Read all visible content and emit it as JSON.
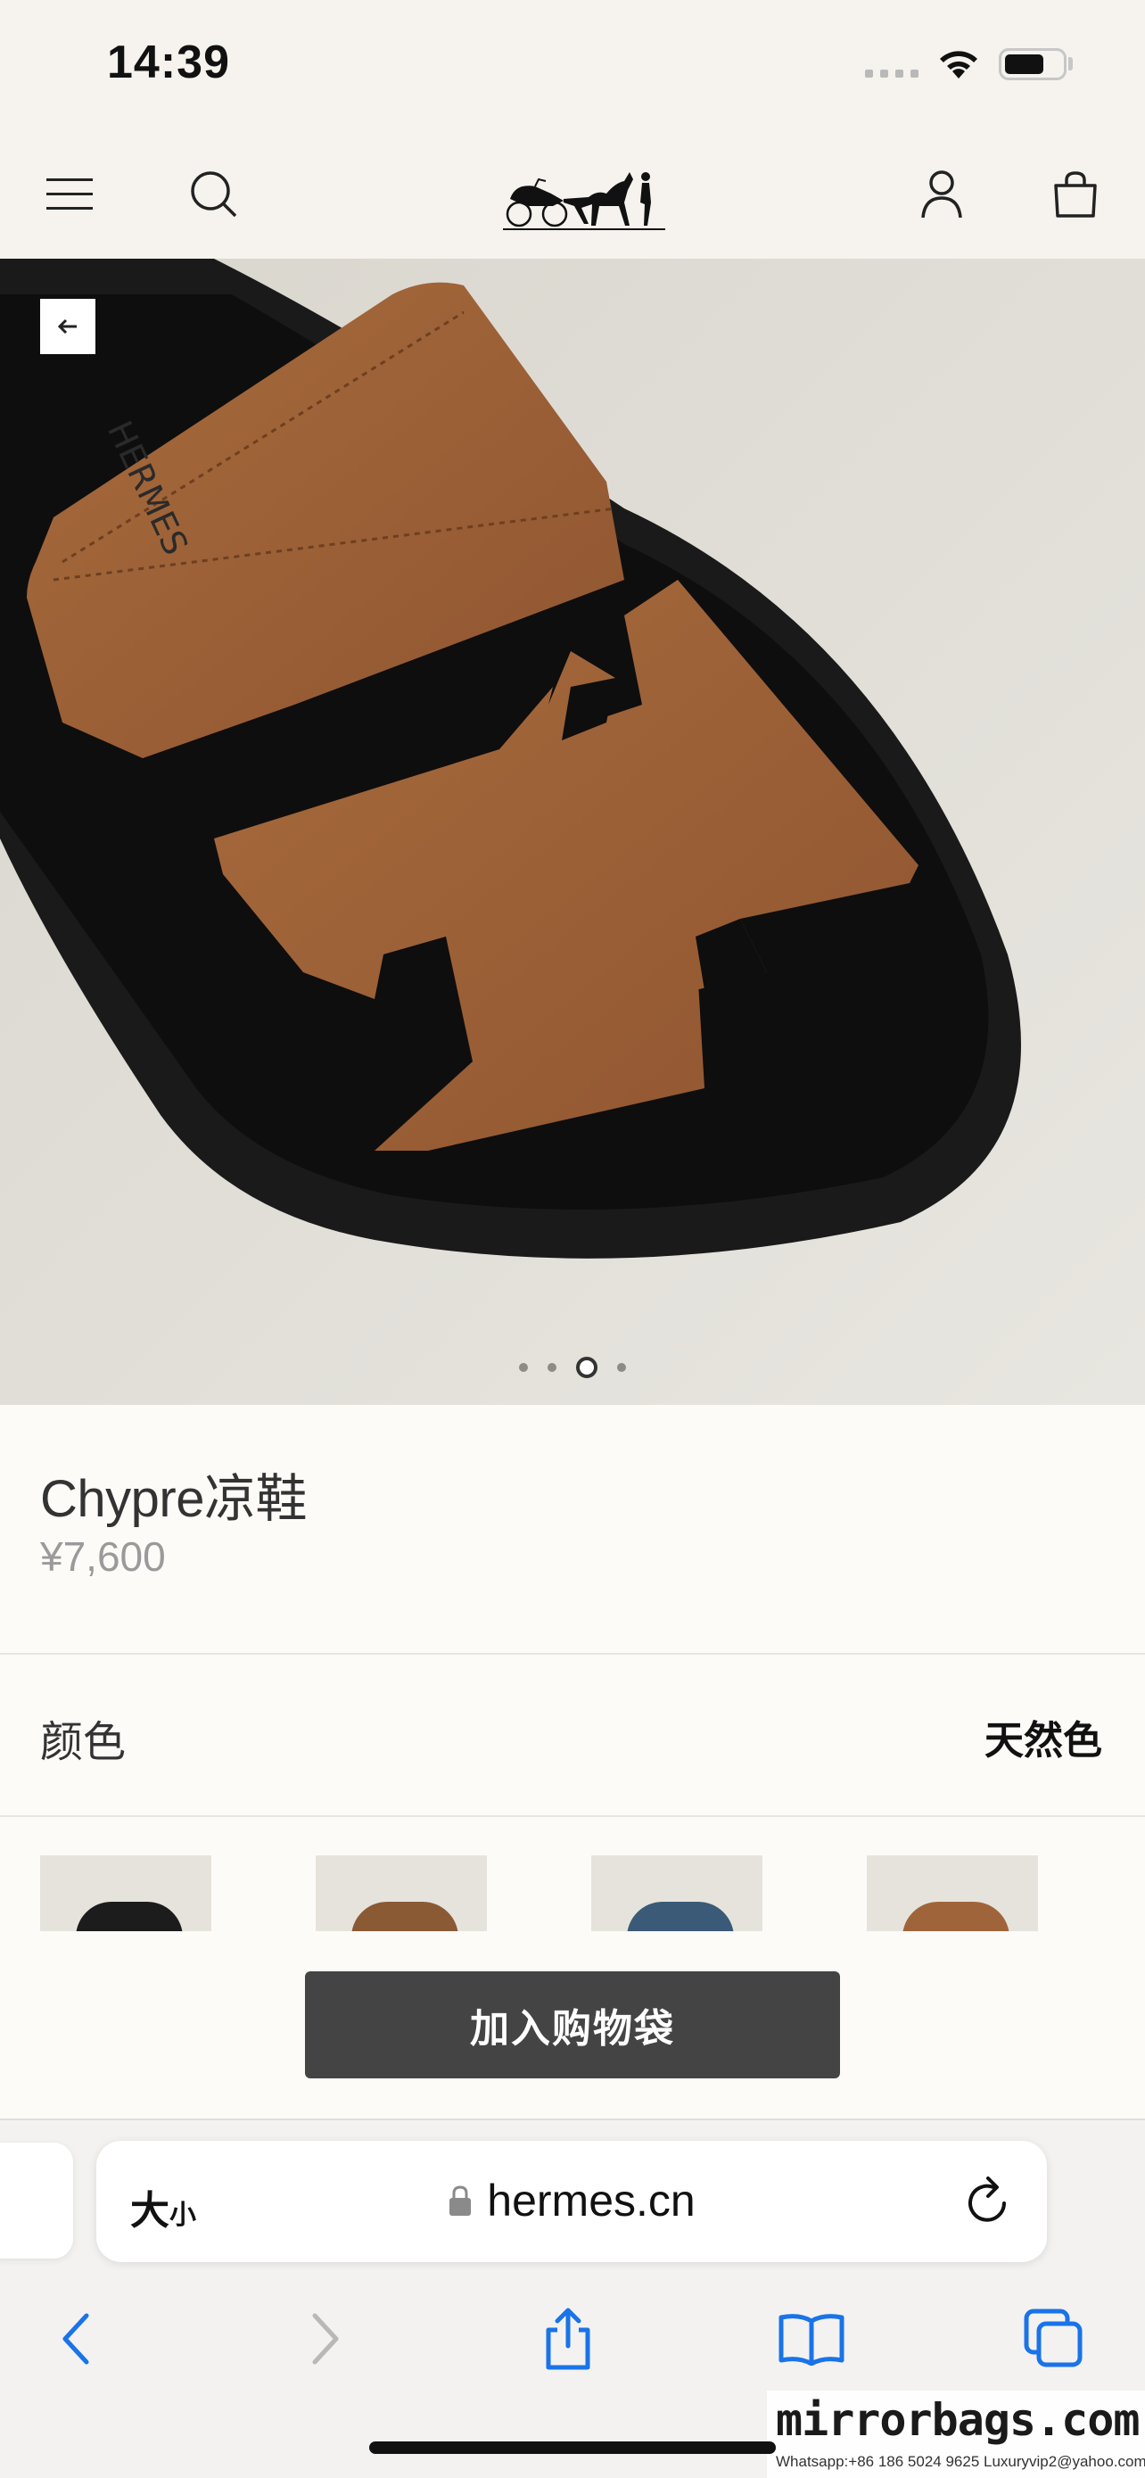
{
  "status_bar": {
    "time": "14:39",
    "battery_percent": 70
  },
  "site_header": {
    "menu_icon": "hamburger-menu-icon",
    "search_icon": "search-icon",
    "logo": "hermes-carriage-logo",
    "account_icon": "user-icon",
    "bag_icon": "shopping-bag-icon"
  },
  "product_image": {
    "back_icon": "arrow-left-icon",
    "carousel": {
      "count": 4,
      "active_index": 2
    }
  },
  "product": {
    "name": "Chypre凉鞋",
    "price": "¥7,600"
  },
  "color": {
    "label": "颜色",
    "value": "天然色"
  },
  "swatches": [
    {
      "name": "black",
      "color": "#1c1c1c"
    },
    {
      "name": "natural",
      "color": "#8a5a34"
    },
    {
      "name": "blue",
      "color": "#3a5a78"
    },
    {
      "name": "tan",
      "color": "#a0643a"
    }
  ],
  "cta": {
    "add_to_bag": "加入购物袋"
  },
  "browser": {
    "reader_label_big": "大",
    "reader_label_small": "小",
    "url": "hermes.cn",
    "reload_icon": "reload-icon",
    "toolbar": [
      "back-icon",
      "forward-icon",
      "share-icon",
      "bookmarks-icon",
      "tabs-icon"
    ]
  },
  "watermark": {
    "brand": "mirrorbags.com",
    "contact": "Whatsapp:+86 186 5024 9625  Luxuryvip2@yahoo.com"
  }
}
